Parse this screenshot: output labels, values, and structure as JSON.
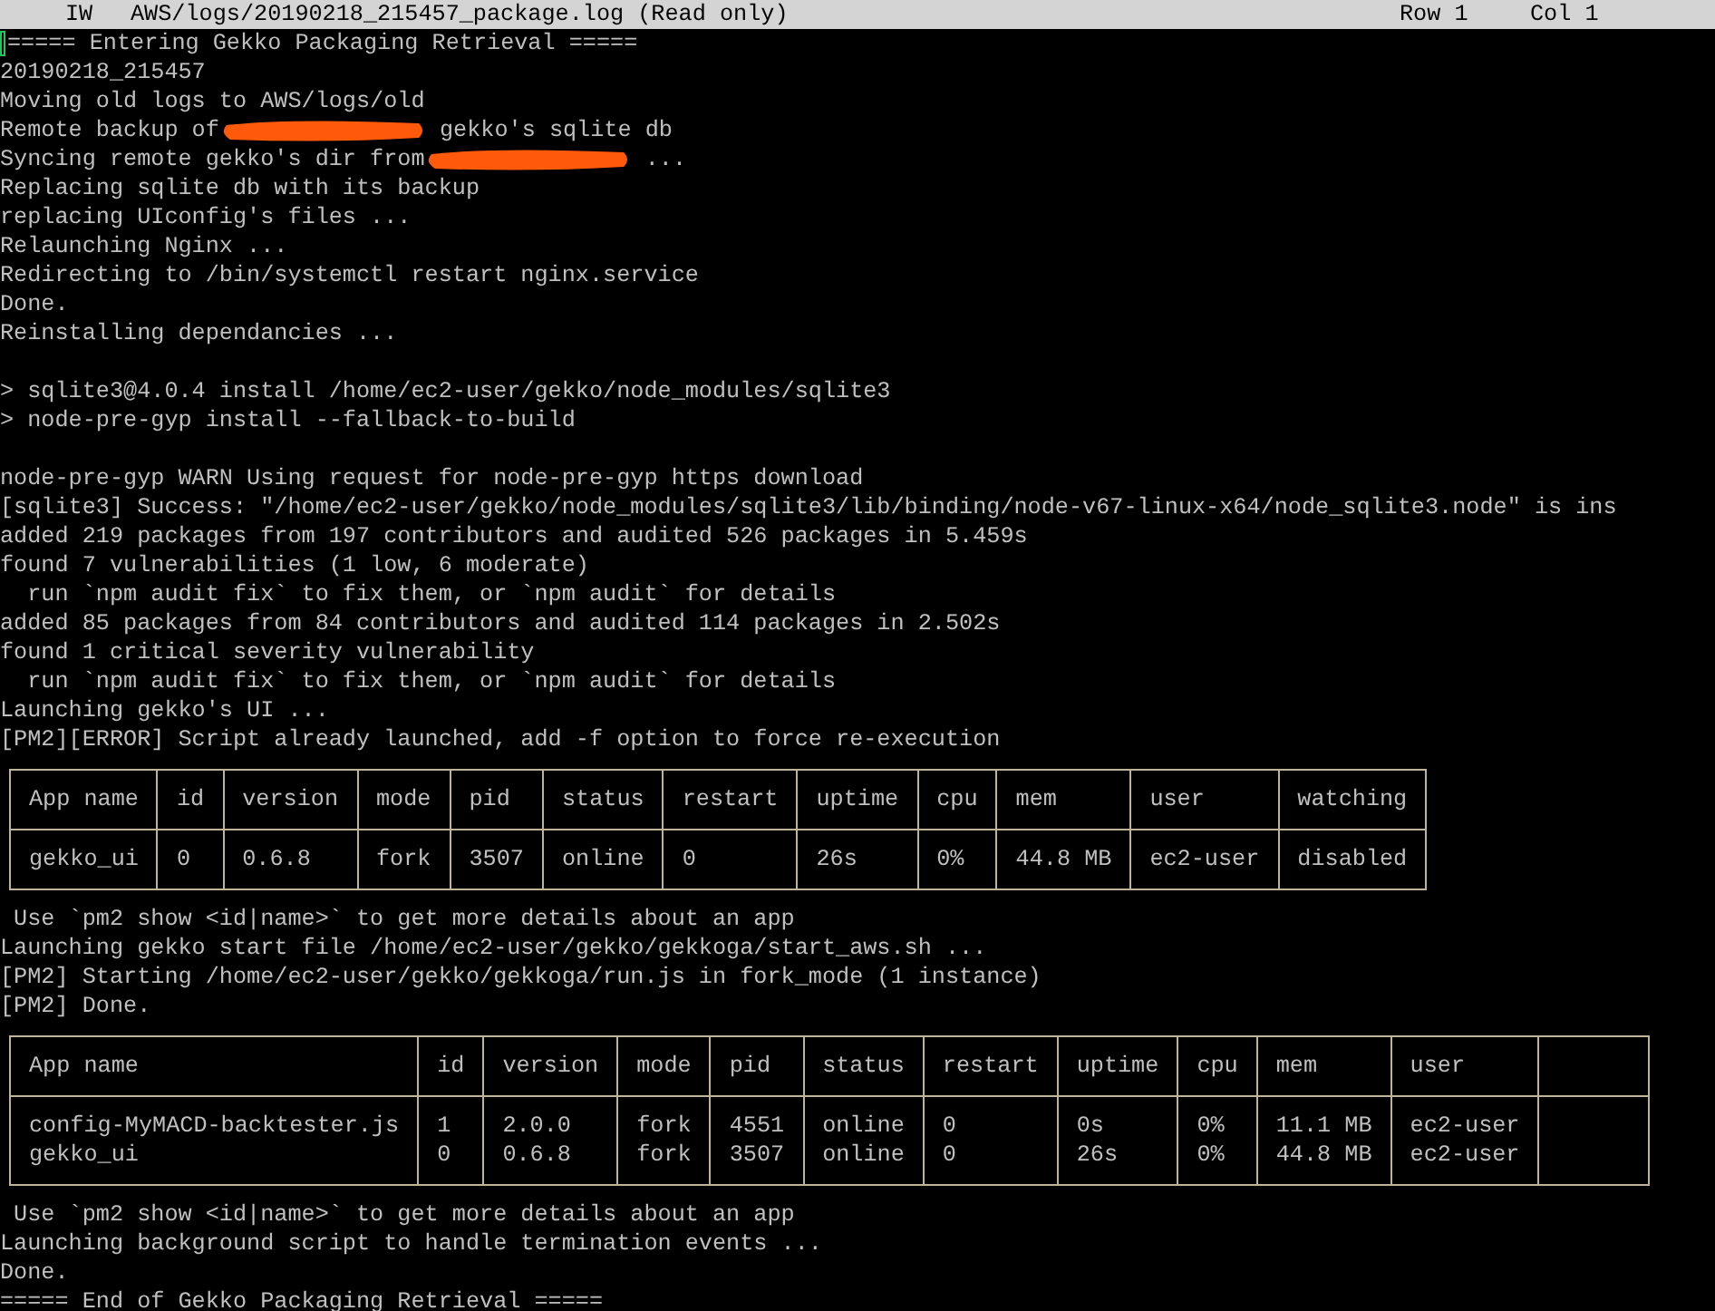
{
  "status_bar": {
    "mode": "IW",
    "file": "AWS/logs/20190218_215457_package.log (Read only)",
    "row": "Row 1",
    "col": "Col 1"
  },
  "lines": [
    {
      "kind": "text",
      "text": "===== Entering Gekko Packaging Retrieval ====="
    },
    {
      "kind": "text",
      "text": "20190218_215457"
    },
    {
      "kind": "text",
      "text": "Moving old logs to AWS/logs/old"
    },
    {
      "kind": "redacted",
      "before": "Remote backup of",
      "after": " gekko's sqlite db"
    },
    {
      "kind": "redacted",
      "before": "Syncing remote gekko's dir from",
      "after": " ..."
    },
    {
      "kind": "text",
      "text": "Replacing sqlite db with its backup"
    },
    {
      "kind": "text",
      "text": "replacing UIconfig's files ..."
    },
    {
      "kind": "text",
      "text": "Relaunching Nginx ..."
    },
    {
      "kind": "text",
      "text": "Redirecting to /bin/systemctl restart nginx.service"
    },
    {
      "kind": "text",
      "text": "Done."
    },
    {
      "kind": "text",
      "text": "Reinstalling dependancies ..."
    },
    {
      "kind": "blank"
    },
    {
      "kind": "text",
      "text": "> sqlite3@4.0.4 install /home/ec2-user/gekko/node_modules/sqlite3"
    },
    {
      "kind": "text",
      "text": "> node-pre-gyp install --fallback-to-build"
    },
    {
      "kind": "blank"
    },
    {
      "kind": "text",
      "text": "node-pre-gyp WARN Using request for node-pre-gyp https download"
    },
    {
      "kind": "text",
      "text": "[sqlite3] Success: \"/home/ec2-user/gekko/node_modules/sqlite3/lib/binding/node-v67-linux-x64/node_sqlite3.node\" is ins"
    },
    {
      "kind": "text",
      "text": "added 219 packages from 197 contributors and audited 526 packages in 5.459s"
    },
    {
      "kind": "text",
      "text": "found 7 vulnerabilities (1 low, 6 moderate)"
    },
    {
      "kind": "text",
      "text": "  run `npm audit fix` to fix them, or `npm audit` for details"
    },
    {
      "kind": "text",
      "text": "added 85 packages from 84 contributors and audited 114 packages in 2.502s"
    },
    {
      "kind": "text",
      "text": "found 1 critical severity vulnerability"
    },
    {
      "kind": "text",
      "text": "  run `npm audit fix` to fix them, or `npm audit` for details"
    },
    {
      "kind": "text",
      "text": "Launching gekko's UI ..."
    },
    {
      "kind": "text",
      "text": "[PM2][ERROR] Script already launched, add -f option to force re-execution"
    },
    {
      "kind": "table",
      "cut_column": false,
      "columns": [
        "App name",
        "id",
        "version",
        "mode",
        "pid",
        "status",
        "restart",
        "uptime",
        "cpu",
        "mem",
        "user",
        "watching"
      ],
      "rows": [
        [
          "gekko_ui",
          "0",
          "0.6.8",
          "fork",
          "3507",
          "online",
          "0",
          "26s",
          "0%",
          "44.8 MB",
          "ec2-user",
          "disabled"
        ]
      ]
    },
    {
      "kind": "text",
      "text": " Use `pm2 show <id|name>` to get more details about an app"
    },
    {
      "kind": "text",
      "text": "Launching gekko start file /home/ec2-user/gekko/gekkoga/start_aws.sh ..."
    },
    {
      "kind": "text",
      "text": "[PM2] Starting /home/ec2-user/gekko/gekkoga/run.js in fork_mode (1 instance)"
    },
    {
      "kind": "text",
      "text": "[PM2] Done."
    },
    {
      "kind": "table",
      "cut_column": true,
      "columns": [
        "App name",
        "id",
        "version",
        "mode",
        "pid",
        "status",
        "restart",
        "uptime",
        "cpu",
        "mem",
        "user"
      ],
      "rows": [
        [
          "config-MyMACD-backtester.js",
          "1",
          "2.0.0",
          "fork",
          "4551",
          "online",
          "0",
          "0s",
          "0%",
          "11.1 MB",
          "ec2-user"
        ],
        [
          "gekko_ui",
          "0",
          "0.6.8",
          "fork",
          "3507",
          "online",
          "0",
          "26s",
          "0%",
          "44.8 MB",
          "ec2-user"
        ]
      ]
    },
    {
      "kind": "text",
      "text": " Use `pm2 show <id|name>` to get more details about an app"
    },
    {
      "kind": "text",
      "text": "Launching background script to handle termination events ..."
    },
    {
      "kind": "text",
      "text": "Done."
    },
    {
      "kind": "text",
      "text": "===== End of Gekko Packaging Retrieval ====="
    }
  ]
}
